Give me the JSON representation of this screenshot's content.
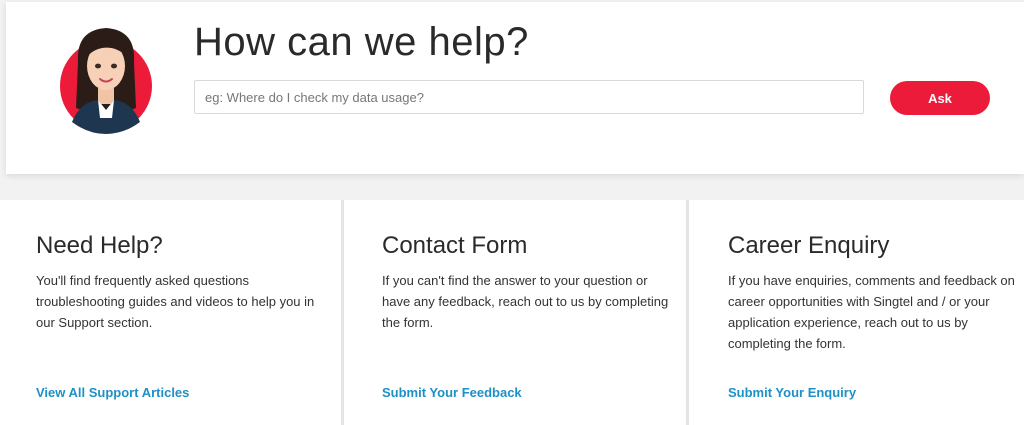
{
  "hero": {
    "title": "How can we help?",
    "search_placeholder": "eg: Where do I check my data usage?",
    "search_value": "",
    "ask_label": "Ask",
    "avatar_icon": "assistant-avatar-icon",
    "accent_color": "#ed1b3a"
  },
  "cards": [
    {
      "title": "Need Help?",
      "body": "You'll find frequently asked questions troubleshooting guides and videos to help you in our Support section.",
      "link": "View All Support Articles"
    },
    {
      "title": "Contact Form",
      "body": "If you can't find the answer to your question or have any feedback, reach out to us by completing the form.",
      "link": "Submit Your Feedback"
    },
    {
      "title": "Career Enquiry",
      "body": "If you have enquiries, comments and feedback on career opportunities with Singtel and / or your application experience, reach out to us by completing the form.",
      "link": "Submit Your Enquiry"
    }
  ],
  "link_color": "#1f90c6"
}
